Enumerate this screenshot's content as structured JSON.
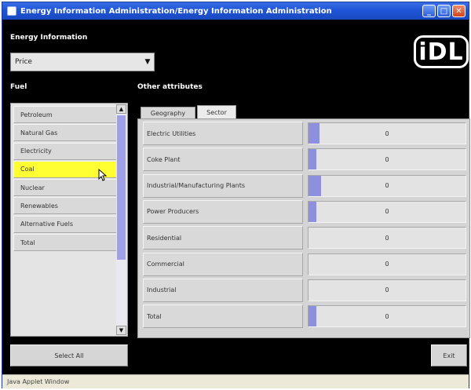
{
  "window": {
    "title": "Energy Information Administration/Energy Information Administration"
  },
  "window_controls": {
    "minimize": "_",
    "maximize": "□",
    "close": "✕"
  },
  "energy_info": {
    "label": "Energy Information",
    "select_value": "Price",
    "select_arrow": "▼"
  },
  "logo": {
    "text": "iDL"
  },
  "fuel": {
    "label": "Fuel",
    "items": [
      {
        "label": "Petroleum"
      },
      {
        "label": "Natural Gas"
      },
      {
        "label": "Electricity"
      },
      {
        "label": "Coal",
        "selected": true
      },
      {
        "label": "Nuclear"
      },
      {
        "label": "Renewables"
      },
      {
        "label": "Alternative Fuels"
      },
      {
        "label": "Total"
      }
    ],
    "scroll_up": "▲",
    "scroll_down": "▼"
  },
  "other_attributes": {
    "label": "Other attributes",
    "tabs": [
      {
        "label": "Geography",
        "active": false
      },
      {
        "label": "Sector",
        "active": true
      }
    ],
    "sectors": [
      {
        "label": "Electric Utilities",
        "value": "0",
        "fill": 0.07
      },
      {
        "label": "Coke Plant",
        "value": "0",
        "fill": 0.05
      },
      {
        "label": "Industrial/Manufacturing Plants",
        "value": "0",
        "fill": 0.08
      },
      {
        "label": "Power Producers",
        "value": "0",
        "fill": 0.05
      },
      {
        "label": "Residential",
        "value": "0",
        "fill": 0.0
      },
      {
        "label": "Commercial",
        "value": "0",
        "fill": 0.0
      },
      {
        "label": "Industrial",
        "value": "0",
        "fill": 0.0
      },
      {
        "label": "Total",
        "value": "0",
        "fill": 0.05
      }
    ]
  },
  "buttons": {
    "select_all": "Select All",
    "exit": "Exit"
  },
  "status": {
    "text": "Java Applet Window"
  },
  "colors": {
    "titlebar": "#1f55d6",
    "selection": "#ffff33",
    "bar_fill": "#8f8fe0",
    "background": "#000000"
  }
}
